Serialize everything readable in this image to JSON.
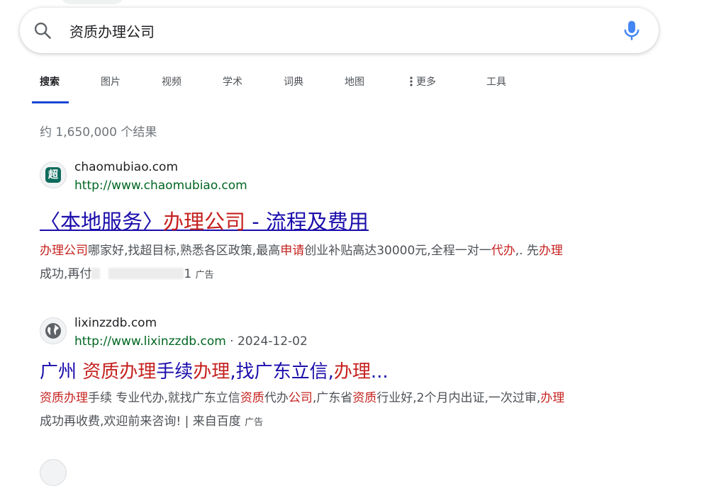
{
  "search": {
    "query": "资质办理公司"
  },
  "tabs": [
    {
      "label": "搜索",
      "active": true
    },
    {
      "label": "图片"
    },
    {
      "label": "视频"
    },
    {
      "label": "学术"
    },
    {
      "label": "词典"
    },
    {
      "label": "地图"
    },
    {
      "label": "更多",
      "icon": "more-vertical-icon"
    },
    {
      "label": "工具"
    }
  ],
  "stats": "约 1,650,000 个结果",
  "results": [
    {
      "favicon_text": "超",
      "favicon_color": "#0d6b5c",
      "site_name": "chaomubiao.com",
      "url": "http://www.chaomubiao.com",
      "title_pre": "〈本地服务〉",
      "title_hl": "办理公司",
      "title_post": " - 流程及费用",
      "snippet_l1": [
        {
          "t": "办理公司",
          "hl": true
        },
        {
          "t": "哪家好,找超目标,熟悉各区政策,最高"
        },
        {
          "t": "申请",
          "hl": true
        },
        {
          "t": "创业补贴高达30000元,全程一对一"
        },
        {
          "t": "代办",
          "hl": true
        },
        {
          "t": ",. 先"
        },
        {
          "t": "办理",
          "hl": true
        }
      ],
      "snippet_l2_pre": "成功,再付",
      "snippet_l2_post": "1",
      "ad_label": "广告"
    },
    {
      "favicon_icon": "globe-icon",
      "site_name": "lixinzzdb.com",
      "url": "http://www.lixinzzdb.com",
      "date": " · 2024-12-02",
      "title": [
        {
          "t": "广州 "
        },
        {
          "t": "资质办理",
          "hl": true
        },
        {
          "t": "手续"
        },
        {
          "t": "办理",
          "hl": true
        },
        {
          "t": ",找广东立信,"
        },
        {
          "t": "办理",
          "hl": true
        },
        {
          "t": "..."
        }
      ],
      "snippet_l1": [
        {
          "t": "资质办理",
          "hl": true
        },
        {
          "t": "手续 专业代办,就找广东立信"
        },
        {
          "t": "资质",
          "hl": true
        },
        {
          "t": "代办"
        },
        {
          "t": "公司",
          "hl": true
        },
        {
          "t": ",广东省"
        },
        {
          "t": "资质",
          "hl": true
        },
        {
          "t": "行业好,2个月内出证,一次过审,"
        },
        {
          "t": "办理",
          "hl": true
        }
      ],
      "snippet_l2": "成功再收费,欢迎前来咨询! | 来自百度",
      "ad_label": "广告"
    }
  ],
  "colors": {
    "link": "#1a0dab",
    "highlight": "#c5221f",
    "url_green": "#006621",
    "tab_underline": "#1a47d6"
  }
}
